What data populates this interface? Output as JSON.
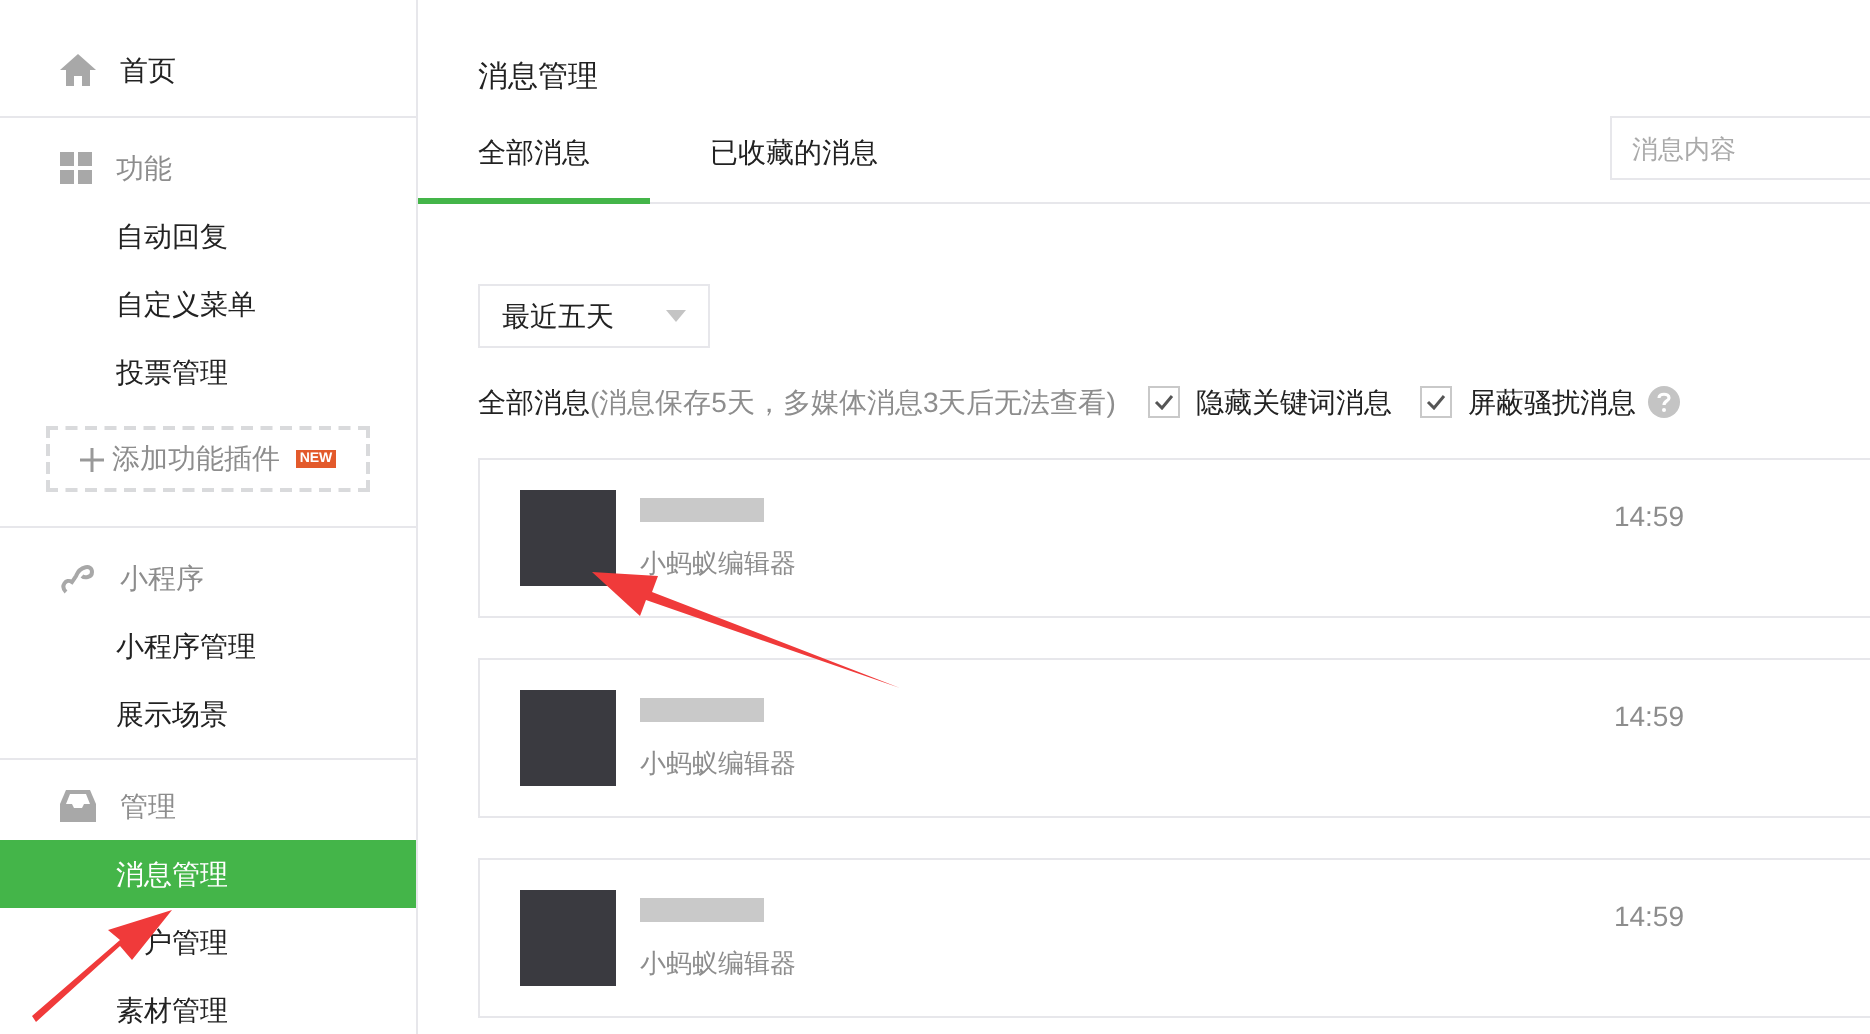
{
  "sidebar": {
    "sections": [
      {
        "title": "首页",
        "kind": "link"
      },
      {
        "title": "功能",
        "kind": "group",
        "items": [
          {
            "label": "自动回复",
            "selected": false
          },
          {
            "label": "自定义菜单",
            "selected": false
          },
          {
            "label": "投票管理",
            "selected": false
          }
        ],
        "add_button": {
          "label": "添加功能插件",
          "badge": "NEW"
        }
      },
      {
        "title": "小程序",
        "kind": "group",
        "items": [
          {
            "label": "小程序管理",
            "selected": false
          },
          {
            "label": "展示场景",
            "selected": false
          }
        ]
      },
      {
        "title": "管理",
        "kind": "group",
        "items": [
          {
            "label": "消息管理",
            "selected": true
          },
          {
            "label": "户管理",
            "selected": false,
            "kind": "partly-covered"
          },
          {
            "label": "素材管理",
            "selected": false
          }
        ]
      }
    ]
  },
  "page_title": "消息管理",
  "tabs": [
    {
      "label": "全部消息",
      "selected": true
    },
    {
      "label": "已收藏的消息",
      "selected": false
    }
  ],
  "search": {
    "placeholder": "消息内容"
  },
  "filter": {
    "value": "最近五天"
  },
  "info": {
    "label": "全部消息",
    "note": "(消息保存5天，多媒体消息3天后无法查看)"
  },
  "options": [
    {
      "label": "隐藏关键词消息",
      "checked": true
    },
    {
      "label": "屏蔽骚扰消息",
      "checked": true
    }
  ],
  "messages": [
    {
      "content": "小蚂蚁编辑器",
      "time": "14:59"
    },
    {
      "content": "小蚂蚁编辑器",
      "time": "14:59"
    },
    {
      "content": "小蚂蚁编辑器",
      "time": "14:59"
    }
  ]
}
